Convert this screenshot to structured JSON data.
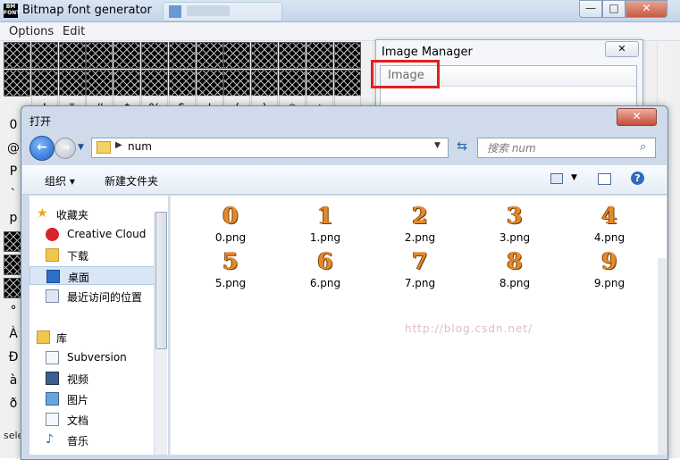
{
  "bfg": {
    "title": "Bitmap font generator",
    "icon_text": "BM FONT",
    "menu": [
      "Options",
      "Edit"
    ],
    "grid_chars": [
      "!",
      "\"",
      "#",
      "$",
      "%",
      "&",
      "'",
      "(",
      ")",
      "*",
      "+",
      ","
    ],
    "left_chars": [
      "0",
      "@",
      "P",
      "`",
      "p",
      "",
      "",
      "",
      "°",
      "À",
      "Ð",
      "à",
      "ð"
    ],
    "status": "sele"
  },
  "image_manager": {
    "title": "Image Manager",
    "column_header": "Image"
  },
  "dialog": {
    "title": "打开",
    "address_path": "num",
    "search_placeholder": "搜索 num",
    "toolbar": {
      "organize": "组织 ▾",
      "new_folder": "新建文件夹"
    },
    "nav": [
      {
        "label": "收藏夹",
        "icon": "star-icon",
        "group": true
      },
      {
        "label": "Creative Cloud",
        "icon": "creative-cloud-icon",
        "group": false
      },
      {
        "label": "下载",
        "icon": "download-folder-icon",
        "group": false
      },
      {
        "label": "桌面",
        "icon": "desktop-icon",
        "group": false,
        "selected": true
      },
      {
        "label": "最近访问的位置",
        "icon": "recent-places-icon",
        "group": false
      },
      {
        "label": "库",
        "icon": "library-icon",
        "group": true
      },
      {
        "label": "Subversion",
        "icon": "document-library-icon",
        "group": false
      },
      {
        "label": "视频",
        "icon": "video-library-icon",
        "group": false
      },
      {
        "label": "图片",
        "icon": "picture-library-icon",
        "group": false
      },
      {
        "label": "文档",
        "icon": "document-library-icon",
        "group": false
      },
      {
        "label": "音乐",
        "icon": "music-library-icon",
        "group": false
      }
    ],
    "files": [
      {
        "glyph": "0",
        "name": "0.png"
      },
      {
        "glyph": "1",
        "name": "1.png"
      },
      {
        "glyph": "2",
        "name": "2.png"
      },
      {
        "glyph": "3",
        "name": "3.png"
      },
      {
        "glyph": "4",
        "name": "4.png"
      },
      {
        "glyph": "5",
        "name": "5.png"
      },
      {
        "glyph": "6",
        "name": "6.png"
      },
      {
        "glyph": "7",
        "name": "7.png"
      },
      {
        "glyph": "8",
        "name": "8.png"
      },
      {
        "glyph": "9",
        "name": "9.png"
      }
    ],
    "watermark": "http://blog.csdn.net/"
  },
  "colors": {
    "highlight_box": "#e02020",
    "digit_fill": "#e6892c",
    "selected_nav": "#d9e6f6"
  }
}
